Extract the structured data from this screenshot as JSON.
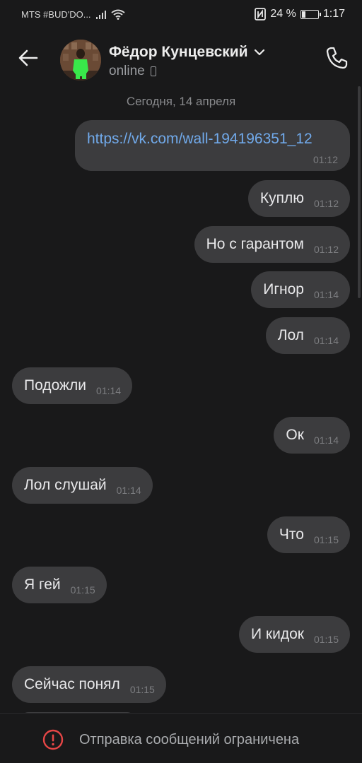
{
  "status_bar": {
    "carrier": "MTS #BUD'DO...",
    "battery_percent": "24 %",
    "battery_level": 0.24,
    "time": "1:17",
    "nfc_icon": "nfc-icon",
    "signal_icon": "signal-icon",
    "wifi_icon": "wifi-icon"
  },
  "header": {
    "contact_name": "Фёдор Кунцевский",
    "status": "online",
    "back_icon": "arrow-left-icon",
    "call_icon": "phone-call-icon",
    "mobile_icon": "mobile-device-icon"
  },
  "chat": {
    "date_separator": "Сегодня, 14 апреля",
    "messages": [
      {
        "direction": "out",
        "text": "https://vk.com/wall-194196351_12",
        "time": "01:12",
        "is_link": true
      },
      {
        "direction": "out",
        "text": "Куплю",
        "time": "01:12"
      },
      {
        "direction": "out",
        "text": "Но с гарантом",
        "time": "01:12"
      },
      {
        "direction": "out",
        "text": "Игнор",
        "time": "01:14"
      },
      {
        "direction": "out",
        "text": "Лол",
        "time": "01:14"
      },
      {
        "direction": "in",
        "text": "Подожли",
        "time": "01:14"
      },
      {
        "direction": "out",
        "text": "Ок",
        "time": "01:14"
      },
      {
        "direction": "in",
        "text": "Лол слушай",
        "time": "01:14"
      },
      {
        "direction": "out",
        "text": "Что",
        "time": "01:15"
      },
      {
        "direction": "in",
        "text": "Я гей",
        "time": "01:15"
      },
      {
        "direction": "out",
        "text": "И кидок",
        "time": "01:15"
      },
      {
        "direction": "in",
        "text": "Сейчас понял",
        "time": "01:15"
      }
    ]
  },
  "bottom": {
    "restriction_text": "Отправка сообщений ограничена",
    "warning_icon": "warning-circle-icon"
  },
  "colors": {
    "background": "#19191a",
    "bubble": "#3c3c3e",
    "link": "#71aaeb",
    "warning": "#e64646"
  }
}
